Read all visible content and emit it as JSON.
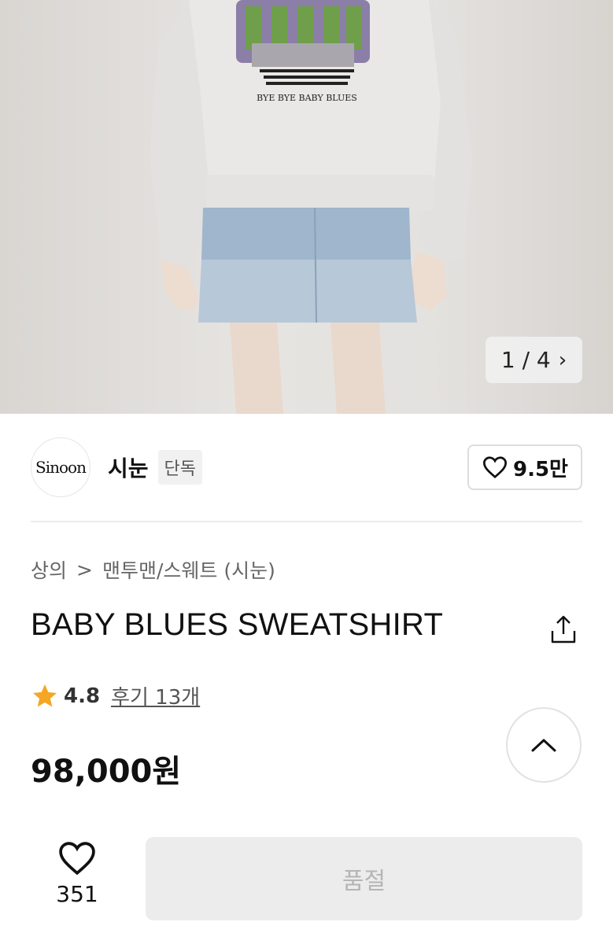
{
  "gallery": {
    "counter": "1 / 4",
    "next_icon": "chevron-right-icon"
  },
  "brand": {
    "logo_text": "Sinoon",
    "name": "시눈",
    "badge": "단독"
  },
  "brand_like": {
    "count": "9.5만",
    "icon": "heart-outline-icon"
  },
  "breadcrumb": {
    "category": "상의",
    "separator": ">",
    "subcategory": "맨투맨/스웨트 (시눈)"
  },
  "product": {
    "title": "BABY BLUES SWEATSHIRT",
    "rating": "4.8",
    "reviews": "후기 13개",
    "price": "98,000원"
  },
  "print_text": "BYE BYE BABY BLUES",
  "bottom_bar": {
    "wish_count": "351",
    "soldout_label": "품절"
  },
  "colors": {
    "star": "#F5A623",
    "soldout_bg": "#ECECEC",
    "soldout_text": "#B5B5B5"
  }
}
